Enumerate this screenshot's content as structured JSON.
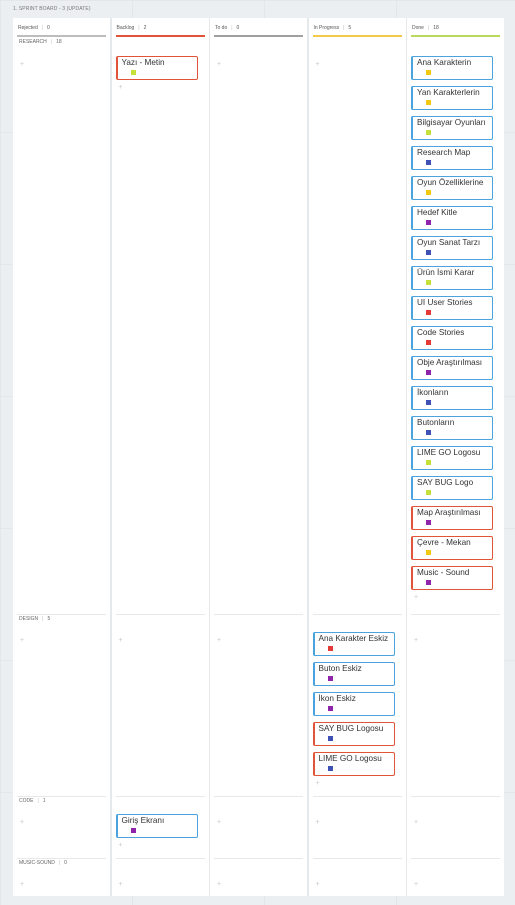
{
  "board_title": "1. SPRINT BOARD - 3 (UPDATE)",
  "columns": [
    {
      "name": "Rejected",
      "count": "0",
      "accent": "#bdbdbd"
    },
    {
      "name": "Backlog",
      "count": "2",
      "accent": "#e0553a"
    },
    {
      "name": "To do",
      "count": "0",
      "accent": "#a0a0a0"
    },
    {
      "name": "In Progress",
      "count": "5",
      "accent": "#f2c94c"
    },
    {
      "name": "Done",
      "count": "18",
      "accent": "#b8d95c"
    }
  ],
  "swimlanes": [
    {
      "name": "RESEARCH",
      "count": "18"
    },
    {
      "name": "DESIGN",
      "count": "5"
    },
    {
      "name": "CODE",
      "count": "1"
    },
    {
      "name": "MUSIC-SOUND",
      "count": "0"
    }
  ],
  "add_symbol": "+",
  "tag_colors": {
    "yellow": "#f2c811",
    "lime": "#c6e03a",
    "blue": "#3f51b5",
    "red": "#e53935",
    "purple": "#8e24aa"
  },
  "card_colors": {
    "border": "#4aa3df",
    "accent_red": "#e0553a"
  },
  "cards": [
    {
      "lane": 0,
      "col": 1,
      "title": "Yazı - Metin",
      "tag": "lime",
      "border": "red"
    },
    {
      "lane": 0,
      "col": 4,
      "title": "Ana Karakterin",
      "tag": "yellow",
      "border": "blue"
    },
    {
      "lane": 0,
      "col": 4,
      "title": "Yan Karakterlerin",
      "tag": "yellow",
      "border": "blue"
    },
    {
      "lane": 0,
      "col": 4,
      "title": "Bilgisayar Oyunları",
      "tag": "lime",
      "border": "blue"
    },
    {
      "lane": 0,
      "col": 4,
      "title": "Research Map",
      "tag": "blue",
      "border": "blue"
    },
    {
      "lane": 0,
      "col": 4,
      "title": "Oyun Özelliklerine",
      "tag": "yellow",
      "border": "blue"
    },
    {
      "lane": 0,
      "col": 4,
      "title": "Hedef Kitle",
      "tag": "purple",
      "border": "blue"
    },
    {
      "lane": 0,
      "col": 4,
      "title": "Oyun Sanat Tarzı",
      "tag": "blue",
      "border": "blue"
    },
    {
      "lane": 0,
      "col": 4,
      "title": "Ürün İsmi Karar",
      "tag": "lime",
      "border": "blue"
    },
    {
      "lane": 0,
      "col": 4,
      "title": "UI User Stories",
      "tag": "red",
      "border": "blue"
    },
    {
      "lane": 0,
      "col": 4,
      "title": "Code Stories",
      "tag": "red",
      "border": "blue"
    },
    {
      "lane": 0,
      "col": 4,
      "title": "Obje Araştırılması",
      "tag": "purple",
      "border": "blue"
    },
    {
      "lane": 0,
      "col": 4,
      "title": "İkonların",
      "tag": "blue",
      "border": "blue"
    },
    {
      "lane": 0,
      "col": 4,
      "title": "Butonların",
      "tag": "blue",
      "border": "blue"
    },
    {
      "lane": 0,
      "col": 4,
      "title": "LIME GO Logosu",
      "tag": "lime",
      "border": "blue"
    },
    {
      "lane": 0,
      "col": 4,
      "title": "SAY BUG Logo",
      "tag": "lime",
      "border": "blue"
    },
    {
      "lane": 0,
      "col": 4,
      "title": "Map Araştırılması",
      "tag": "purple",
      "border": "red"
    },
    {
      "lane": 0,
      "col": 4,
      "title": "Çevre - Mekan",
      "tag": "yellow",
      "border": "red"
    },
    {
      "lane": 0,
      "col": 4,
      "title": "Music - Sound",
      "tag": "purple",
      "border": "red"
    },
    {
      "lane": 1,
      "col": 3,
      "title": "Ana Karakter Eskiz",
      "tag": "red",
      "border": "blue"
    },
    {
      "lane": 1,
      "col": 3,
      "title": "Buton Eskiz",
      "tag": "purple",
      "border": "blue"
    },
    {
      "lane": 1,
      "col": 3,
      "title": "İkon Eskiz",
      "tag": "purple",
      "border": "blue"
    },
    {
      "lane": 1,
      "col": 3,
      "title": "SAY BUG Logosu",
      "tag": "blue",
      "border": "red"
    },
    {
      "lane": 1,
      "col": 3,
      "title": "LIME GO Logosu",
      "tag": "blue",
      "border": "red"
    },
    {
      "lane": 2,
      "col": 1,
      "title": "Giriş Ekranı",
      "tag": "purple",
      "border": "blue"
    }
  ]
}
